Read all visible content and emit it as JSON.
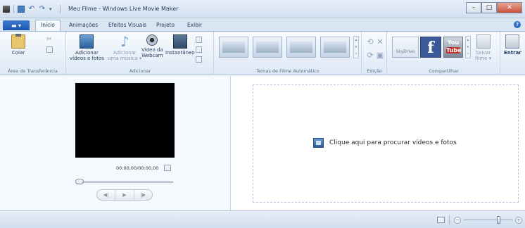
{
  "window": {
    "title": "Meu Filme - Windows Live Movie Maker"
  },
  "tabs": [
    "Início",
    "Animações",
    "Efeitos Visuais",
    "Projeto",
    "Exibir"
  ],
  "groups": {
    "clipboard": {
      "label": "Área de Transferência",
      "paste": "Colar"
    },
    "add": {
      "label": "Adicionar",
      "add_media": [
        "Adicionar",
        "vídeos e fotos"
      ],
      "add_music": [
        "Adicionar",
        "uma música"
      ],
      "webcam": [
        "Vídeo da",
        "Webcam"
      ],
      "snapshot": "Instantâneo"
    },
    "themes": {
      "label": "Temas de Filme Automático"
    },
    "edit": {
      "label": "Edição"
    },
    "share": {
      "label": "Compartilhar",
      "skydrive": "SkyDrive",
      "facebook": "f",
      "youtube": [
        "You",
        "Tube"
      ],
      "save_movie": [
        "Salvar",
        "filme"
      ],
      "sign_in": "Entrar"
    }
  },
  "preview": {
    "timecode": "00:00,00/00:00,00"
  },
  "storyboard": {
    "prompt": "Clique aqui para procurar vídeos e fotos"
  }
}
